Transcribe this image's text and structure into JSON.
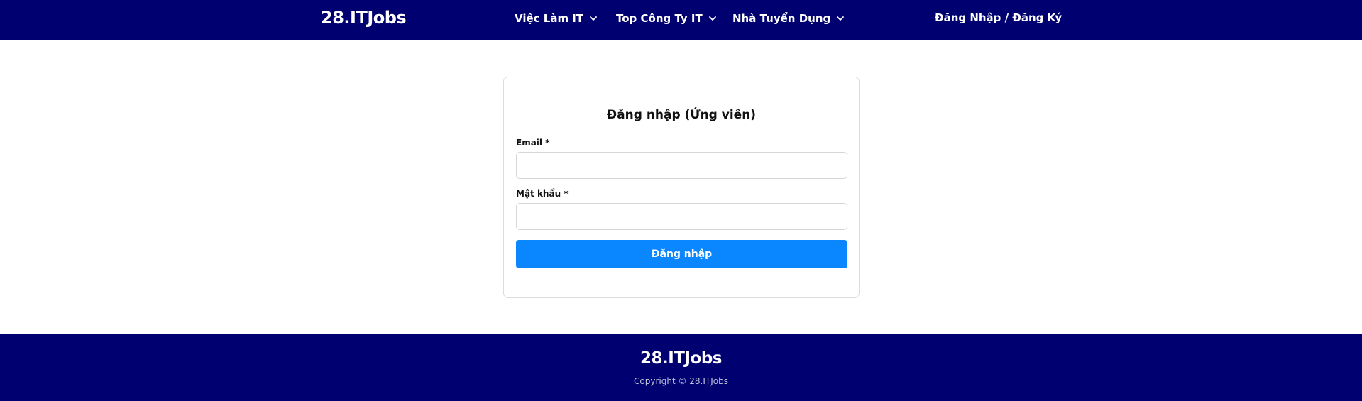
{
  "header": {
    "logo": "28.ITJobs",
    "nav": [
      {
        "label": "Việc Làm IT",
        "icon": "chevron-down-icon"
      },
      {
        "label": "Top Công Ty IT",
        "icon": "chevron-down-icon"
      },
      {
        "label": "Nhà Tuyển Dụng",
        "icon": "chevron-down-icon"
      }
    ],
    "auth_link": "Đăng Nhập / Đăng Ký"
  },
  "login": {
    "title": "Đăng nhập (Ứng viên)",
    "email_label": "Email *",
    "email_value": "",
    "password_label": "Mật khẩu *",
    "password_value": "",
    "submit_label": "Đăng nhập"
  },
  "footer": {
    "logo": "28.ITJobs",
    "copyright": "Copyright © 28.ITJobs"
  },
  "colors": {
    "header_bg": "#000070",
    "footer_bg": "#000070",
    "primary_button": "#0a87ff"
  }
}
